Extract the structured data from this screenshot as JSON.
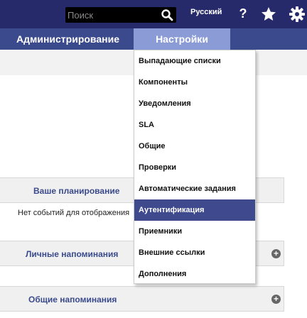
{
  "search": {
    "placeholder": "Поиск",
    "value": ""
  },
  "topbar": {
    "language": "Русский",
    "help_label": "?"
  },
  "nav": {
    "admin_label": "Администрирование",
    "settings_label": "Настройки"
  },
  "panels": {
    "planning": {
      "title": "Ваше планирование",
      "empty_text": "Нет событий для отображения"
    },
    "personal_reminders": {
      "title": "Личные напоминания"
    },
    "general_reminders": {
      "title": "Общие напоминания"
    }
  },
  "settings_menu": {
    "items": [
      {
        "label": "Выпадающие списки"
      },
      {
        "label": "Компоненты"
      },
      {
        "label": "Уведомления"
      },
      {
        "label": "SLA"
      },
      {
        "label": "Общие"
      },
      {
        "label": "Проверки"
      },
      {
        "label": "Автоматические задания"
      },
      {
        "label": "Аутентификация",
        "active": true
      },
      {
        "label": "Приемники"
      },
      {
        "label": "Внешние ссылки"
      },
      {
        "label": "Дополнения"
      }
    ]
  },
  "colors": {
    "topbar": "#262a6a",
    "navbar": "#3a4a8c",
    "nav_active": "#8a9bd6",
    "menu_active": "#3f4a8e"
  }
}
